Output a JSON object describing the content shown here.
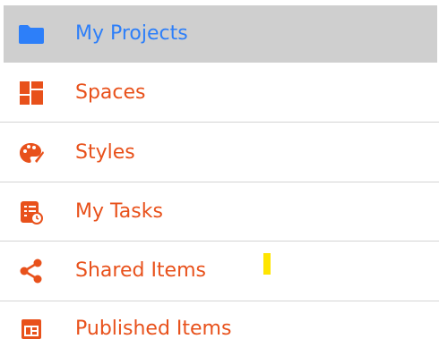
{
  "menu": {
    "items": [
      {
        "label": "My Projects",
        "icon": "folder-icon",
        "active": true
      },
      {
        "label": "Spaces",
        "icon": "grid-layout-icon"
      },
      {
        "label": "Styles",
        "icon": "palette-icon"
      },
      {
        "label": "My Tasks",
        "icon": "task-checklist-icon"
      },
      {
        "label": "Shared Items",
        "icon": "share-icon"
      },
      {
        "label": "Published Items",
        "icon": "published-page-icon"
      }
    ]
  },
  "colors": {
    "active_bg": "#cfcfcf",
    "active_text": "#2d7ff9",
    "item_text": "#e8511b",
    "divider": "#d4d4d4",
    "highlight_marker": "#ffe500"
  }
}
